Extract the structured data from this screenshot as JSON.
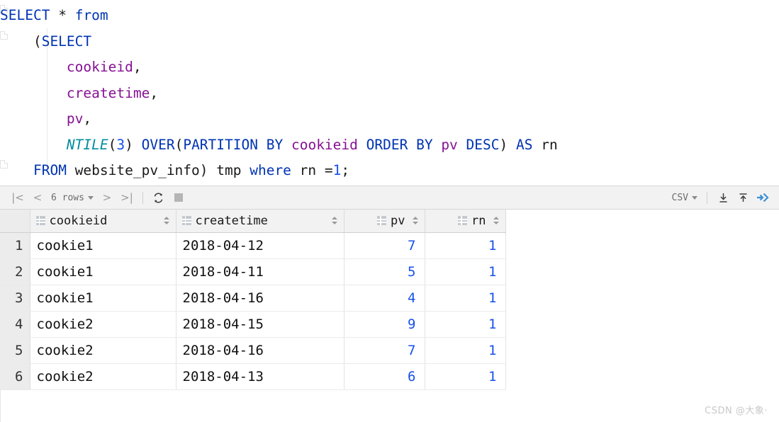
{
  "editor": {
    "language": "sql",
    "lines": [
      [
        {
          "t": "SELECT",
          "c": "kw"
        },
        {
          "t": " ",
          "c": "pl"
        },
        {
          "t": "*",
          "c": "pl"
        },
        {
          "t": " ",
          "c": "pl"
        },
        {
          "t": "from",
          "c": "kw"
        }
      ],
      [
        {
          "t": "    (",
          "c": "pl"
        },
        {
          "t": "SELECT",
          "c": "kw"
        }
      ],
      [
        {
          "t": "        ",
          "c": "pl"
        },
        {
          "t": "cookieid",
          "c": "id"
        },
        {
          "t": ",",
          "c": "pl"
        }
      ],
      [
        {
          "t": "        ",
          "c": "pl"
        },
        {
          "t": "createtime",
          "c": "id"
        },
        {
          "t": ",",
          "c": "pl"
        }
      ],
      [
        {
          "t": "        ",
          "c": "pl"
        },
        {
          "t": "pv",
          "c": "id"
        },
        {
          "t": ",",
          "c": "pl"
        }
      ],
      [
        {
          "t": "        ",
          "c": "pl"
        },
        {
          "t": "NTILE",
          "c": "fn"
        },
        {
          "t": "(",
          "c": "pl"
        },
        {
          "t": "3",
          "c": "num"
        },
        {
          "t": ") ",
          "c": "pl"
        },
        {
          "t": "OVER",
          "c": "kw"
        },
        {
          "t": "(",
          "c": "pl"
        },
        {
          "t": "PARTITION BY",
          "c": "kw"
        },
        {
          "t": " ",
          "c": "pl"
        },
        {
          "t": "cookieid",
          "c": "id"
        },
        {
          "t": " ",
          "c": "pl"
        },
        {
          "t": "ORDER BY",
          "c": "kw"
        },
        {
          "t": " ",
          "c": "pl"
        },
        {
          "t": "pv",
          "c": "id"
        },
        {
          "t": " ",
          "c": "pl"
        },
        {
          "t": "DESC",
          "c": "kw"
        },
        {
          "t": ") ",
          "c": "pl"
        },
        {
          "t": "AS",
          "c": "kw"
        },
        {
          "t": " rn",
          "c": "pl"
        }
      ],
      [
        {
          "t": "    ",
          "c": "pl"
        },
        {
          "t": "FROM",
          "c": "kw"
        },
        {
          "t": " website_pv_info) tmp ",
          "c": "pl"
        },
        {
          "t": "where",
          "c": "kw"
        },
        {
          "t": " rn =",
          "c": "pl"
        },
        {
          "t": "1",
          "c": "num"
        },
        {
          "t": ";",
          "c": "pl"
        }
      ]
    ],
    "plain_text": "SELECT * from\n    (SELECT\n        cookieid,\n        createtime,\n        pv,\n        NTILE(3) OVER(PARTITION BY cookieid ORDER BY pv DESC) AS rn\n    FROM website_pv_info) tmp where rn =1;",
    "colors": {
      "keyword": "#0033b3",
      "identifier": "#871094",
      "function": "#008c9e",
      "number": "#1750eb",
      "plain": "#1a1a1a"
    }
  },
  "toolbar": {
    "first_page_icon": "first-page-icon",
    "prev_page_icon": "previous-page-icon",
    "row_count_label": "6 rows",
    "next_page_icon": "next-page-icon",
    "last_page_icon": "last-page-icon",
    "refresh_icon": "refresh-icon",
    "stop_icon": "stop-icon",
    "format_label": "CSV",
    "download_icon": "download-icon",
    "upload_icon": "upload-icon",
    "expand_icon": "expand-arrows-icon",
    "accent_color": "#3c8fd4"
  },
  "grid": {
    "columns": [
      {
        "name": "cookieid",
        "align": "left"
      },
      {
        "name": "createtime",
        "align": "left"
      },
      {
        "name": "pv",
        "align": "right"
      },
      {
        "name": "rn",
        "align": "right"
      }
    ],
    "rows": [
      {
        "n": "1",
        "cookieid": "cookie1",
        "createtime": "2018-04-12",
        "pv": "7",
        "rn": "1"
      },
      {
        "n": "2",
        "cookieid": "cookie1",
        "createtime": "2018-04-11",
        "pv": "5",
        "rn": "1"
      },
      {
        "n": "3",
        "cookieid": "cookie1",
        "createtime": "2018-04-16",
        "pv": "4",
        "rn": "1"
      },
      {
        "n": "4",
        "cookieid": "cookie2",
        "createtime": "2018-04-15",
        "pv": "9",
        "rn": "1"
      },
      {
        "n": "5",
        "cookieid": "cookie2",
        "createtime": "2018-04-16",
        "pv": "7",
        "rn": "1"
      },
      {
        "n": "6",
        "cookieid": "cookie2",
        "createtime": "2018-04-13",
        "pv": "6",
        "rn": "1"
      }
    ]
  },
  "watermark": {
    "text": "CSDN @大象·"
  }
}
